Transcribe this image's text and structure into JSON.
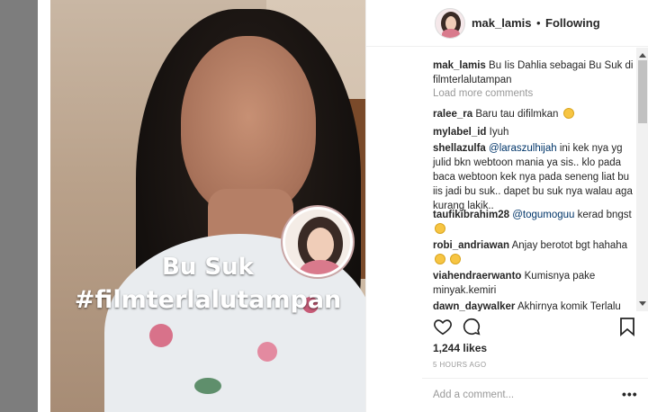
{
  "header": {
    "username": "mak_lamis",
    "separator": "•",
    "follow_state": "Following"
  },
  "media": {
    "overlay_line1": "Bu Suk",
    "overlay_line2": "#filmterlalutampan"
  },
  "caption": {
    "user": "mak_lamis",
    "text": "Bu Iis Dahlia sebagai Bu Suk di filmterlalutampan"
  },
  "load_more": "Load more comments",
  "comments": [
    {
      "user": "ralee_ra",
      "text": "Baru tau difilmkan",
      "emoji": "sad-face-emoji"
    },
    {
      "user": "mylabel_id",
      "text": "Iyuh"
    },
    {
      "user": "shellazulfa",
      "mention": "@laraszulhijah",
      "text": "ini kek nya yg julid bkn webtoon mania ya sis.. klo pada baca webtoon kek nya pada seneng liat bu iis jadi bu suk.. dapet bu suk nya walau aga kurang lakik.."
    },
    {
      "user": "taufikibrahim28",
      "mention": "@togumoguu",
      "text": "kerad bngst",
      "emoji": "laughing-emoji"
    },
    {
      "user": "robi_andriawan",
      "text": "Anjay berotot bgt hahaha",
      "emoji": "laughing-emoji"
    },
    {
      "user": "viahendraerwanto",
      "text": "Kumisnya pake minyak.kemiri"
    },
    {
      "user": "dawn_daywalker",
      "text": "Akhirnya komik Terlalu"
    }
  ],
  "footer": {
    "likes": "1,244 likes",
    "time": "5 HOURS AGO",
    "add_comment_placeholder": "Add a comment...",
    "more_label": "•••"
  },
  "icons": {
    "like": "heart-icon",
    "comment": "comment-icon",
    "save": "bookmark-icon",
    "more": "more-options-icon"
  }
}
